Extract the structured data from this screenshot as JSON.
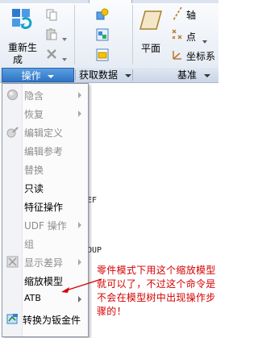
{
  "ribbon": {
    "regenerate_label_line1": "重新生",
    "regenerate_label_line2": "成",
    "plane_label": "平面",
    "axis_label": "轴",
    "point_label": "点",
    "csys_label": "坐标系",
    "groups": {
      "operations": "操作",
      "get_data": "获取数据",
      "datum": "基准"
    }
  },
  "background_text": [
    "EF",
    "OUP"
  ],
  "menu": {
    "items": [
      {
        "label": "隐含",
        "disabled": true,
        "submenu": true,
        "icon": "suppress-icon"
      },
      {
        "label": "恢复",
        "disabled": true,
        "submenu": true,
        "icon": ""
      },
      {
        "label": "编辑定义",
        "disabled": true,
        "submenu": false,
        "icon": "edit-definition-icon"
      },
      {
        "label": "编辑参考",
        "disabled": true,
        "submenu": false,
        "icon": ""
      },
      {
        "label": "替换",
        "disabled": true,
        "submenu": false,
        "icon": ""
      },
      {
        "label": "只读",
        "disabled": false,
        "submenu": false,
        "icon": ""
      },
      {
        "label": "特征操作",
        "disabled": false,
        "submenu": false,
        "icon": ""
      },
      {
        "label": "UDF 操作",
        "disabled": true,
        "submenu": true,
        "icon": ""
      },
      {
        "label": "组",
        "disabled": true,
        "submenu": false,
        "icon": ""
      },
      {
        "label": "显示差异",
        "disabled": true,
        "submenu": true,
        "icon": "display-diff-icon"
      },
      {
        "label": "缩放模型",
        "disabled": false,
        "submenu": false,
        "icon": ""
      },
      {
        "label": "ATB",
        "disabled": false,
        "submenu": true,
        "icon": ""
      },
      {
        "label": "转换为钣金件",
        "disabled": false,
        "submenu": false,
        "icon": "convert-sheetmetal-icon"
      }
    ]
  },
  "annotation": {
    "text": "零件模式下用这个缩放模型就可以了，不过这个命令是不会在模型树中出现操作步骤的！",
    "color": "#d40000"
  },
  "colors": {
    "active_group": "#2f74c6",
    "annotation": "#d40000"
  }
}
